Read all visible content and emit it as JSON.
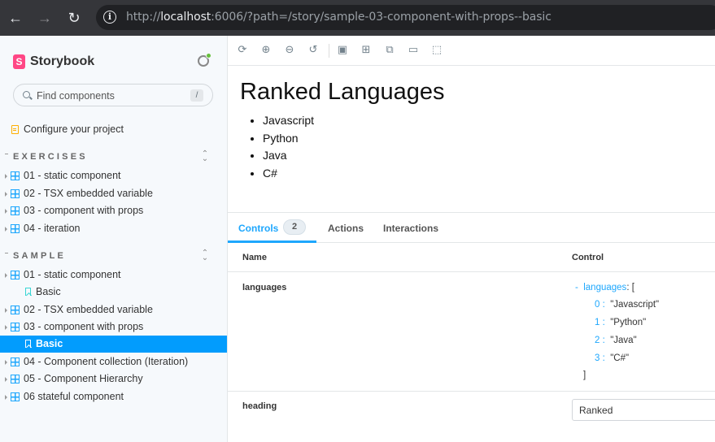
{
  "browser": {
    "url_prefix": "http://",
    "url_host": "localhost",
    "url_rest": ":6006/?path=/story/sample-03-component-with-props--basic",
    "back_icon": "arrow-left-icon",
    "forward_icon": "arrow-right-icon",
    "reload_icon": "reload-icon"
  },
  "sidebar": {
    "brand": "Storybook",
    "brand_logo_letter": "S",
    "search_placeholder": "Find components",
    "search_shortcut": "/",
    "configure": "Configure your project",
    "sections": [
      {
        "title": "EXERCISES",
        "items": [
          {
            "label": "01 - static component"
          },
          {
            "label": "02 - TSX embedded variable"
          },
          {
            "label": "03 - component with props"
          },
          {
            "label": "04 - iteration"
          }
        ]
      },
      {
        "title": "SAMPLE",
        "items": [
          {
            "label": "01 - static component",
            "story": "Basic"
          },
          {
            "label": "02 - TSX embedded variable"
          },
          {
            "label": "03 - component with props",
            "story": "Basic",
            "selected": true
          },
          {
            "label": "04 - Component collection (Iteration)"
          },
          {
            "label": "05 - Component Hierarchy"
          },
          {
            "label": "06 stateful component"
          }
        ]
      }
    ]
  },
  "canvas": {
    "heading": "Ranked Languages",
    "languages": [
      "Javascript",
      "Python",
      "Java",
      "C#"
    ]
  },
  "addons": {
    "tabs": [
      {
        "label": "Controls",
        "badge": "2",
        "active": true
      },
      {
        "label": "Actions"
      },
      {
        "label": "Interactions"
      }
    ],
    "columns": {
      "name": "Name",
      "control": "Control"
    },
    "props": {
      "languages": {
        "name": "languages",
        "toggle": "-",
        "key": "languages",
        "open": ": [",
        "close": "]",
        "entries": [
          {
            "index": "0",
            "value": "\"Javascript\""
          },
          {
            "index": "1",
            "value": "\"Python\""
          },
          {
            "index": "2",
            "value": "\"Java\""
          },
          {
            "index": "3",
            "value": "\"C#\""
          }
        ]
      },
      "heading": {
        "name": "heading",
        "value": "Ranked"
      }
    }
  },
  "colors": {
    "accent": "#1ea7fd",
    "selected": "#029cfd",
    "brand": "#ff4785"
  }
}
